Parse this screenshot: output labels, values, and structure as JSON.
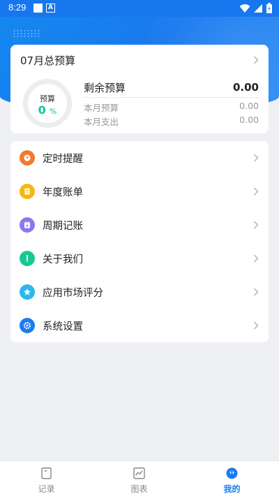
{
  "status_bar": {
    "time": "8:29",
    "notif_icon": "A"
  },
  "budget": {
    "title": "07月总预算",
    "ring_label": "预算",
    "percent": "0",
    "percent_unit": "%",
    "remaining_label": "剩余预算",
    "remaining_value": "0.00",
    "month_budget_label": "本月预算",
    "month_budget_value": "0.00",
    "month_spend_label": "本月支出",
    "month_spend_value": "0.00"
  },
  "menu": [
    {
      "label": "定时提醒",
      "icon": "alarm-clock-icon",
      "color": "#f4782b"
    },
    {
      "label": "年度账单",
      "icon": "annual-bill-icon",
      "color": "#f9b515"
    },
    {
      "label": "周期记账",
      "icon": "calendar-icon",
      "color": "#8e77ee"
    },
    {
      "label": "关于我们",
      "icon": "info-icon",
      "color": "#17c895"
    },
    {
      "label": "应用市场评分",
      "icon": "star-icon",
      "color": "#2cb8ec"
    },
    {
      "label": "系统设置",
      "icon": "gear-icon",
      "color": "#1a7cf0"
    }
  ],
  "tabs": [
    {
      "label": "记录",
      "icon": "record-icon",
      "active": false
    },
    {
      "label": "图表",
      "icon": "chart-icon",
      "active": false
    },
    {
      "label": "我的",
      "icon": "profile-icon",
      "active": true
    }
  ],
  "colors": {
    "primary": "#1a7cf0",
    "accent_green": "#14c29a"
  }
}
